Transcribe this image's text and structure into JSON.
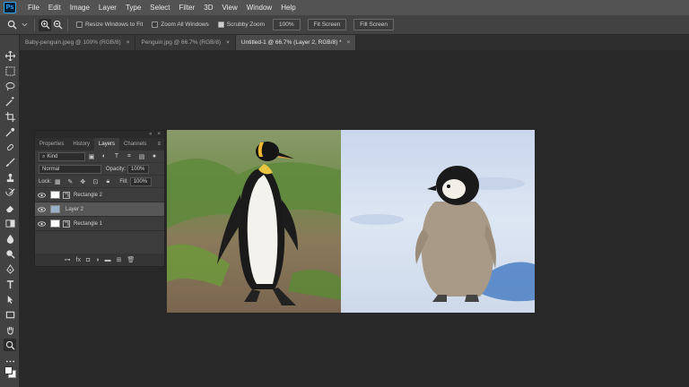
{
  "app": {
    "logo": "Ps"
  },
  "menu": [
    "File",
    "Edit",
    "Image",
    "Layer",
    "Type",
    "Select",
    "Filter",
    "3D",
    "View",
    "Window",
    "Help"
  ],
  "options": {
    "resize_windows": "Resize Windows to Fit",
    "zoom_all": "Zoom All Windows",
    "scrubby_zoom": "Scrubby Zoom",
    "zoom_value": "100%",
    "fit_screen": "Fit Screen",
    "fill_screen": "Fill Screen",
    "scrubby_checked": true
  },
  "tabs": [
    {
      "label": "Baby-penguin.jpeg @ 100% (RGB/8)",
      "active": false
    },
    {
      "label": "Penguin.jpg @ 66.7% (RGB/8)",
      "active": false
    },
    {
      "label": "Untitled-1 @ 66.7% (Layer 2, RGB/8) *",
      "active": true
    }
  ],
  "layers_panel": {
    "tabs": [
      "Properties",
      "History",
      "Layers",
      "Channels"
    ],
    "active_tab": "Layers",
    "filter_label": "Kind",
    "blend_mode": "Normal",
    "opacity_label": "Opacity:",
    "opacity_value": "100%",
    "lock_label": "Lock:",
    "fill_label": "Fill:",
    "fill_value": "100%",
    "layers": [
      {
        "name": "Rectangle 2",
        "selected": false
      },
      {
        "name": "Layer 2",
        "selected": true
      },
      {
        "name": "Rectangle 1",
        "selected": false
      }
    ]
  },
  "colors": {
    "accent": "#31a8ff",
    "canvas_bg": "#282828",
    "panel_bg": "#3c3c3c"
  }
}
